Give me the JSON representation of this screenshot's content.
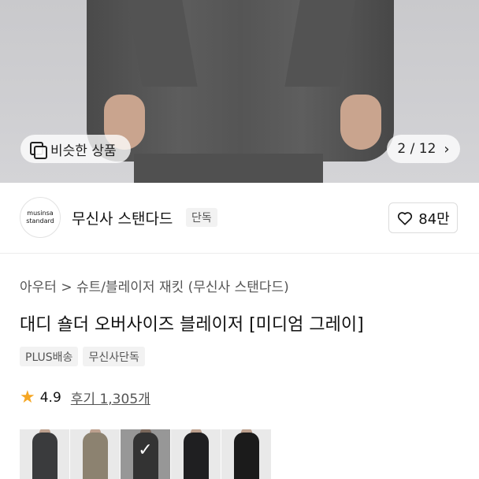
{
  "hero": {
    "similar_label": "비슷한 상품",
    "counter": "2 / 12",
    "counter_chevron": "›",
    "similar_icon": "similar-squares-icon"
  },
  "brand": {
    "logo_line1": "musinsa",
    "logo_line2": "standard",
    "name": "무신사 스탠다드",
    "tag": "단독",
    "likes": "84만",
    "like_icon": "heart-outline-icon"
  },
  "product": {
    "breadcrumb": "아우터 > 슈트/블레이저 재킷 (무신사 스탠다드)",
    "title": "대디 숄더 오버사이즈 블레이저 [미디엄 그레이]",
    "badges": [
      "PLUS배송",
      "무신사단독"
    ],
    "rating": "4.9",
    "reviews": "후기 1,305개",
    "star_color": "#f5a623"
  },
  "thumbnails": [
    {
      "color": "#3a3b3d",
      "selected": false
    },
    {
      "color": "#8c8270",
      "selected": false
    },
    {
      "color": "#4f4f4f",
      "selected": true
    },
    {
      "color": "#1f1f21",
      "selected": false
    },
    {
      "color": "#1b1b1b",
      "selected": false
    }
  ],
  "selected_check": "✓"
}
